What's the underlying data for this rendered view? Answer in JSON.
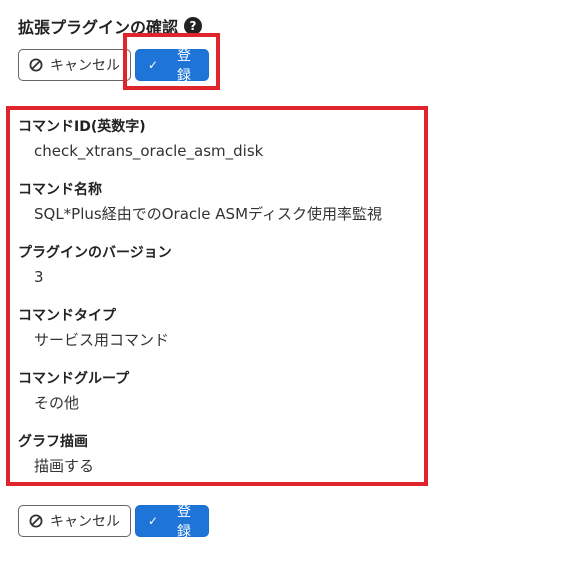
{
  "page": {
    "title": "拡張プラグインの確認",
    "help_icon": "question-circle-icon"
  },
  "actions": {
    "cancel_label": "キャンセル",
    "cancel_icon": "ban-icon",
    "register_label": "登録",
    "register_icon": "check-icon"
  },
  "fields": [
    {
      "label": "コマンドID(英数字)",
      "value": "check_xtrans_oracle_asm_disk"
    },
    {
      "label": "コマンド名称",
      "value": "SQL*Plus経由でのOracle ASMディスク使用率監視"
    },
    {
      "label": "プラグインのバージョン",
      "value": "3"
    },
    {
      "label": "コマンドタイプ",
      "value": "サービス用コマンド"
    },
    {
      "label": "コマンドグループ",
      "value": "その他"
    },
    {
      "label": "グラフ描画",
      "value": "描画する"
    }
  ],
  "colors": {
    "primary": "#1f74d8",
    "highlight": "#e0242b"
  }
}
